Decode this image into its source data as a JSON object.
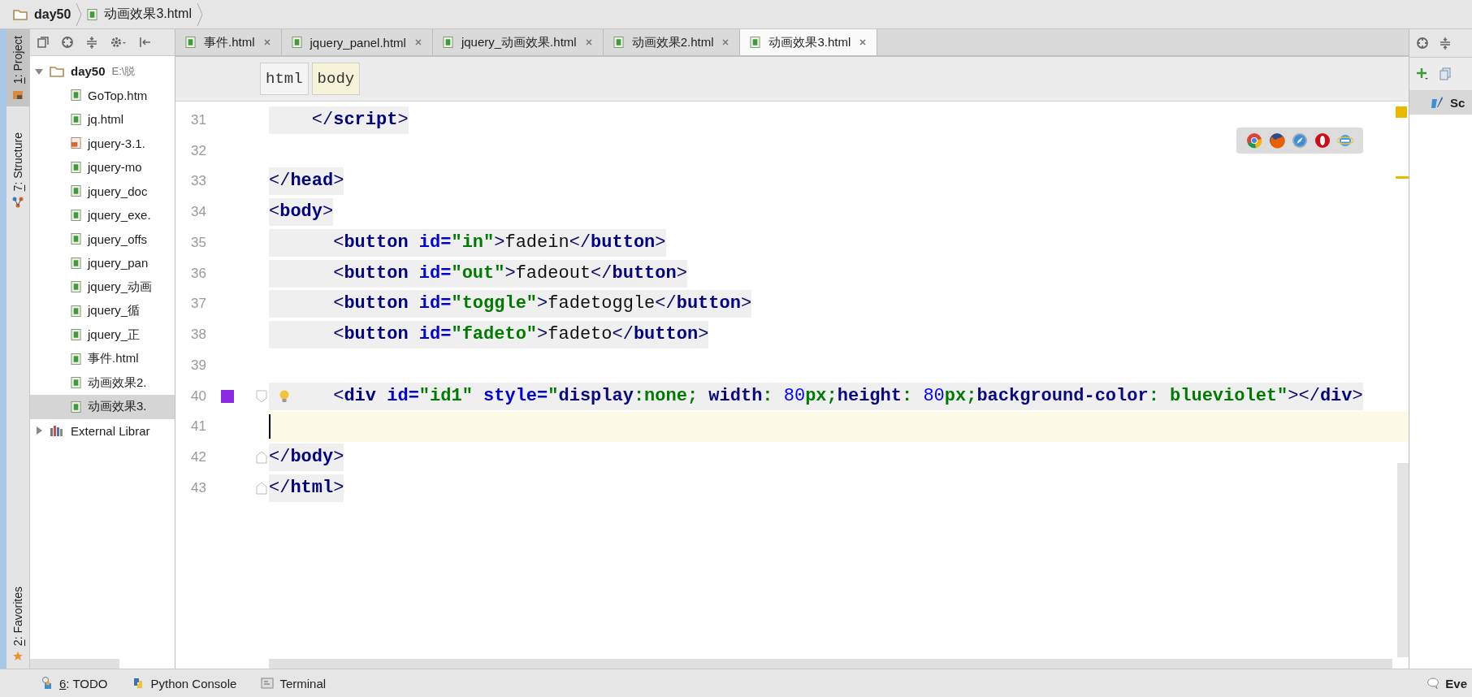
{
  "breadcrumb": [
    {
      "label": "day50",
      "kind": "folder"
    },
    {
      "label": "动画效果3.html",
      "kind": "html"
    }
  ],
  "tool_strip_top": [
    {
      "label": "1: Project",
      "kind": "project",
      "selected": true
    },
    {
      "label": "7: Structure",
      "kind": "structure",
      "selected": false
    }
  ],
  "tool_strip_bottom": [
    {
      "label": "2: Favorites",
      "kind": "favorites",
      "selected": false
    }
  ],
  "project_tree": [
    {
      "label": "day50",
      "path": "E:\\脱",
      "kind": "folder",
      "expanded": true,
      "selected": false,
      "children": [
        {
          "label": "GoTop.htm",
          "kind": "html",
          "selected": false
        },
        {
          "label": "jq.html",
          "kind": "html",
          "selected": false
        },
        {
          "label": "jquery-3.1.",
          "kind": "js",
          "selected": false
        },
        {
          "label": "jquery-mo",
          "kind": "html",
          "selected": false
        },
        {
          "label": "jquery_doc",
          "kind": "html",
          "selected": false
        },
        {
          "label": "jquery_exe.",
          "kind": "html",
          "selected": false
        },
        {
          "label": "jquery_offs",
          "kind": "html",
          "selected": false
        },
        {
          "label": "jquery_pan",
          "kind": "html",
          "selected": false
        },
        {
          "label": "jquery_动画",
          "kind": "html",
          "selected": false
        },
        {
          "label": "jquery_循",
          "kind": "html",
          "selected": false
        },
        {
          "label": "jquery_正",
          "kind": "html",
          "selected": false
        },
        {
          "label": "事件.html",
          "kind": "html",
          "selected": false
        },
        {
          "label": "动画效果2.",
          "kind": "html",
          "selected": false
        },
        {
          "label": "动画效果3.",
          "kind": "html",
          "selected": true
        }
      ]
    },
    {
      "label": "External Librar",
      "kind": "library",
      "expanded": false,
      "selected": false
    }
  ],
  "editor_tabs": [
    {
      "label": "事件.html",
      "selected": false
    },
    {
      "label": "jquery_panel.html",
      "selected": false
    },
    {
      "label": "jquery_动画效果.html",
      "selected": false
    },
    {
      "label": "动画效果2.html",
      "selected": false
    },
    {
      "label": "动画效果3.html",
      "selected": true
    }
  ],
  "editor_breadcrumb": [
    {
      "label": "html",
      "selected": false
    },
    {
      "label": "body",
      "selected": true
    }
  ],
  "code_lines": [
    {
      "number": "31",
      "current": false,
      "fold_start": false,
      "fold_end": false,
      "bulb": false,
      "segments": [
        {
          "kind": "punct",
          "text": "    </"
        },
        {
          "kind": "tag",
          "text": "script"
        },
        {
          "kind": "punct",
          "text": ">"
        }
      ]
    },
    {
      "number": "32",
      "current": false,
      "fold_start": false,
      "fold_end": false,
      "bulb": false
    },
    {
      "number": "33",
      "current": false,
      "fold_start": false,
      "fold_end": false,
      "bulb": false,
      "segments": [
        {
          "kind": "punct",
          "text": "</"
        },
        {
          "kind": "tag",
          "text": "head"
        },
        {
          "kind": "punct",
          "text": ">"
        }
      ]
    },
    {
      "number": "34",
      "current": false,
      "fold_start": false,
      "fold_end": false,
      "bulb": false,
      "segments": [
        {
          "kind": "punct",
          "text": "<"
        },
        {
          "kind": "tag",
          "text": "body"
        },
        {
          "kind": "punct",
          "text": ">"
        }
      ]
    },
    {
      "number": "35",
      "current": false,
      "fold_start": false,
      "fold_end": false,
      "bulb": false,
      "segments": [
        {
          "kind": "punct",
          "text": "      <"
        },
        {
          "kind": "tag",
          "text": "button "
        },
        {
          "kind": "attr",
          "text": "id="
        },
        {
          "kind": "string",
          "text": "\"in\""
        },
        {
          "kind": "punct",
          "text": ">"
        },
        {
          "kind": "text",
          "text": "fadein"
        },
        {
          "kind": "punct",
          "text": "</"
        },
        {
          "kind": "tag",
          "text": "button"
        },
        {
          "kind": "punct",
          "text": ">"
        }
      ]
    },
    {
      "number": "36",
      "current": false,
      "fold_start": false,
      "fold_end": false,
      "bulb": false,
      "segments": [
        {
          "kind": "punct",
          "text": "      <"
        },
        {
          "kind": "tag",
          "text": "button "
        },
        {
          "kind": "attr",
          "text": "id="
        },
        {
          "kind": "string",
          "text": "\"out\""
        },
        {
          "kind": "punct",
          "text": ">"
        },
        {
          "kind": "text",
          "text": "fadeout"
        },
        {
          "kind": "punct",
          "text": "</"
        },
        {
          "kind": "tag",
          "text": "button"
        },
        {
          "kind": "punct",
          "text": ">"
        }
      ]
    },
    {
      "number": "37",
      "current": false,
      "fold_start": false,
      "fold_end": false,
      "bulb": false,
      "segments": [
        {
          "kind": "punct",
          "text": "      <"
        },
        {
          "kind": "tag",
          "text": "button "
        },
        {
          "kind": "attr",
          "text": "id="
        },
        {
          "kind": "string",
          "text": "\"toggle\""
        },
        {
          "kind": "punct",
          "text": ">"
        },
        {
          "kind": "text",
          "text": "fadetoggle"
        },
        {
          "kind": "punct",
          "text": "</"
        },
        {
          "kind": "tag",
          "text": "button"
        },
        {
          "kind": "punct",
          "text": ">"
        }
      ]
    },
    {
      "number": "38",
      "current": false,
      "fold_start": false,
      "fold_end": false,
      "bulb": false,
      "segments": [
        {
          "kind": "punct",
          "text": "      <"
        },
        {
          "kind": "tag",
          "text": "button "
        },
        {
          "kind": "attr",
          "text": "id="
        },
        {
          "kind": "string",
          "text": "\"fadeto\""
        },
        {
          "kind": "punct",
          "text": ">"
        },
        {
          "kind": "text",
          "text": "fadeto"
        },
        {
          "kind": "punct",
          "text": "</"
        },
        {
          "kind": "tag",
          "text": "button"
        },
        {
          "kind": "punct",
          "text": ">"
        }
      ]
    },
    {
      "number": "39",
      "current": false,
      "fold_start": false,
      "fold_end": false,
      "bulb": false
    },
    {
      "number": "40",
      "current": false,
      "fold_start": true,
      "fold_end": false,
      "bulb": true,
      "color": "#8a2be2",
      "segments": [
        {
          "kind": "punct",
          "text": "      <"
        },
        {
          "kind": "tag",
          "text": "div "
        },
        {
          "kind": "attr",
          "text": "id="
        },
        {
          "kind": "string",
          "text": "\"id1\" "
        },
        {
          "kind": "attr",
          "text": "style="
        },
        {
          "kind": "string",
          "text": "\""
        },
        {
          "kind": "prop",
          "text": "display"
        },
        {
          "kind": "string",
          "text": ":none; "
        },
        {
          "kind": "prop",
          "text": "width"
        },
        {
          "kind": "string",
          "text": ": "
        },
        {
          "kind": "num",
          "text": "80"
        },
        {
          "kind": "string",
          "text": "px;"
        },
        {
          "kind": "prop",
          "text": "height"
        },
        {
          "kind": "string",
          "text": ": "
        },
        {
          "kind": "num",
          "text": "80"
        },
        {
          "kind": "string",
          "text": "px;"
        },
        {
          "kind": "prop",
          "text": "background-color"
        },
        {
          "kind": "string",
          "text": ": blueviolet\""
        },
        {
          "kind": "punct",
          "text": "></"
        },
        {
          "kind": "tag",
          "text": "div"
        },
        {
          "kind": "punct",
          "text": ">"
        }
      ]
    },
    {
      "number": "41",
      "current": true,
      "fold_start": false,
      "fold_end": false,
      "bulb": false
    },
    {
      "number": "42",
      "current": false,
      "fold_start": false,
      "fold_end": true,
      "bulb": false,
      "segments": [
        {
          "kind": "punct",
          "text": "</"
        },
        {
          "kind": "tag",
          "text": "body"
        },
        {
          "kind": "punct",
          "text": ">"
        }
      ]
    },
    {
      "number": "43",
      "current": false,
      "fold_start": false,
      "fold_end": true,
      "bulb": false,
      "segments": [
        {
          "kind": "punct",
          "text": "</"
        },
        {
          "kind": "tag",
          "text": "html"
        },
        {
          "kind": "punct",
          "text": ">"
        }
      ]
    }
  ],
  "right_panel": {
    "item": "Sc"
  },
  "bottom_tools": [
    {
      "label": "6: TODO",
      "kind": "todo"
    },
    {
      "label": "Python Console",
      "kind": "python"
    },
    {
      "label": "Terminal",
      "kind": "terminal"
    }
  ],
  "bottom_right": {
    "label": "Eve"
  }
}
